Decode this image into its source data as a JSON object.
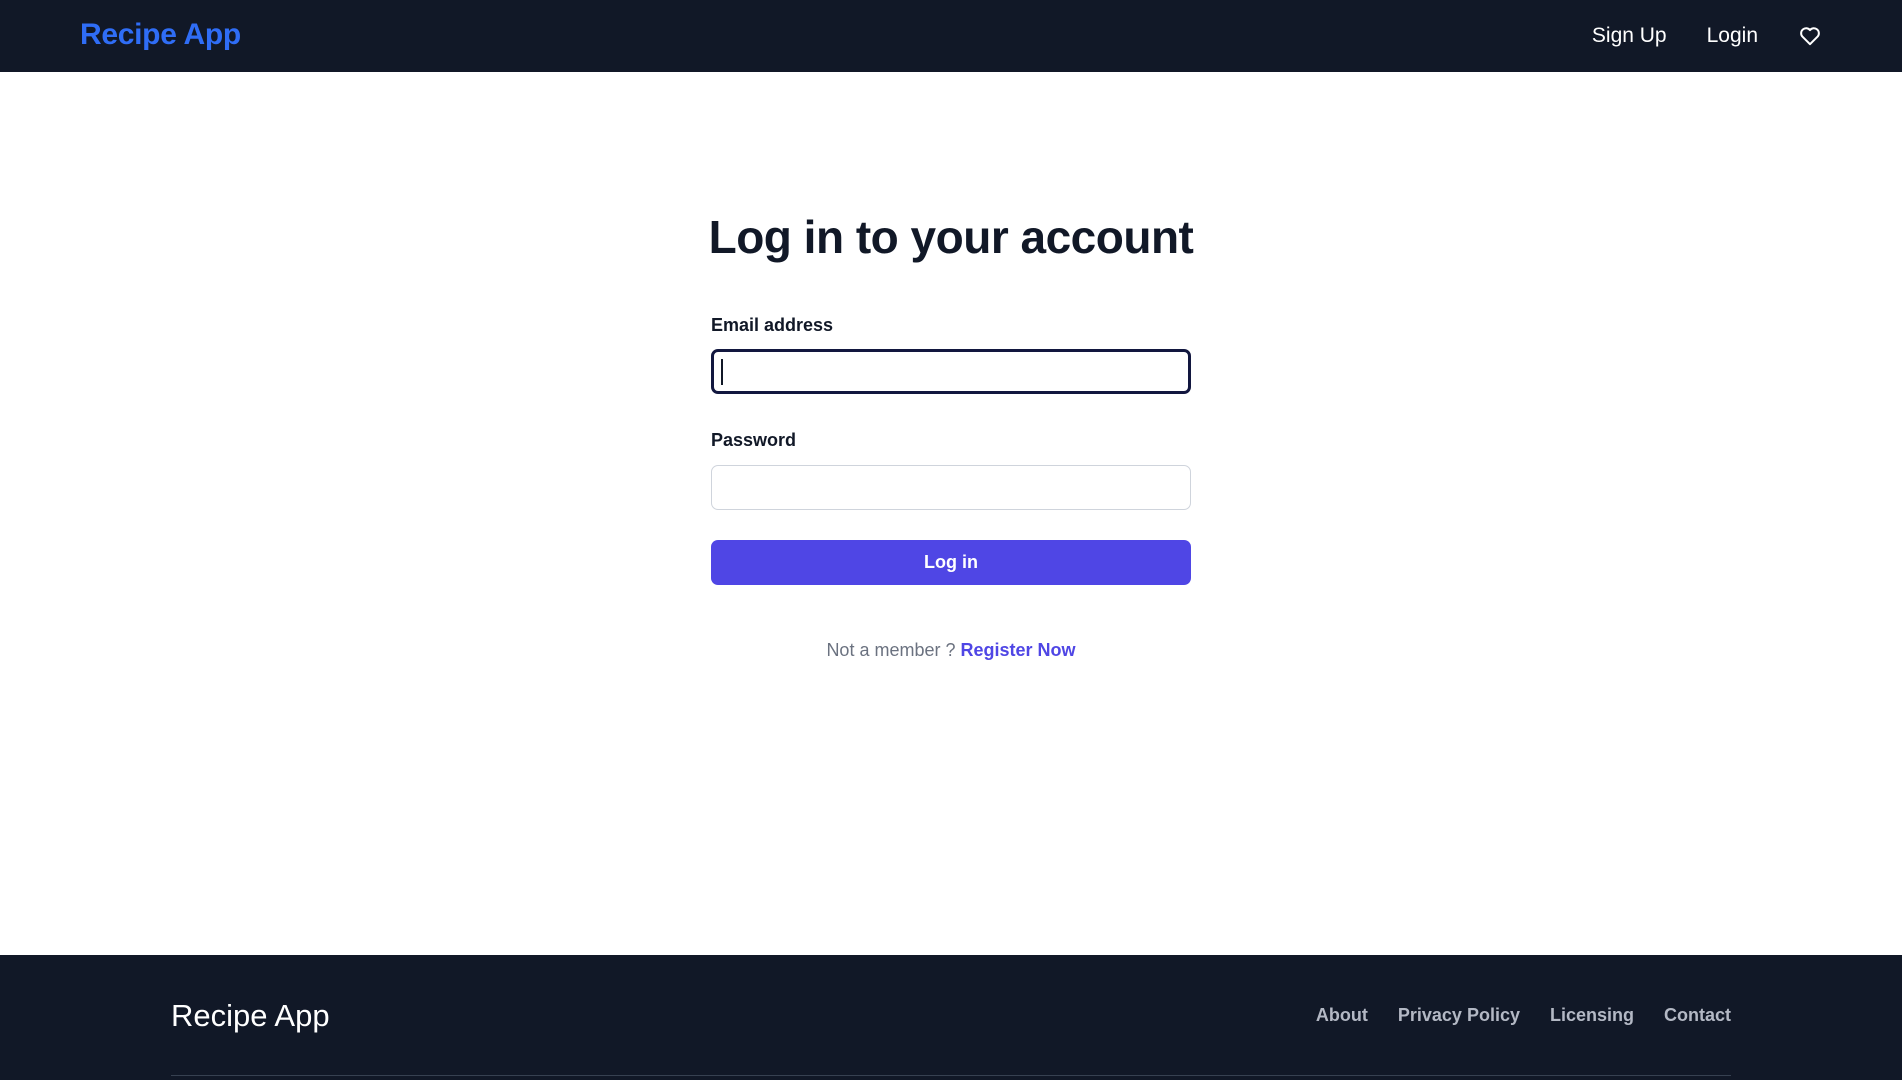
{
  "header": {
    "brand": "Recipe App",
    "brand_color": "#2f6df6",
    "background": "#111827",
    "nav": {
      "signup_label": "Sign Up",
      "login_label": "Login",
      "favorites_icon": "heart-icon"
    }
  },
  "form": {
    "title": "Log in to your account",
    "email": {
      "label": "Email address",
      "value": "",
      "placeholder": ""
    },
    "password": {
      "label": "Password",
      "value": "",
      "placeholder": ""
    },
    "submit_label": "Log in",
    "accent_color": "#4f46e5",
    "member_prompt": "Not a member ?",
    "register_label": "Register Now"
  },
  "footer": {
    "brand": "Recipe App",
    "links": {
      "about": "About",
      "privacy": "Privacy Policy",
      "licensing": "Licensing",
      "contact": "Contact"
    }
  }
}
